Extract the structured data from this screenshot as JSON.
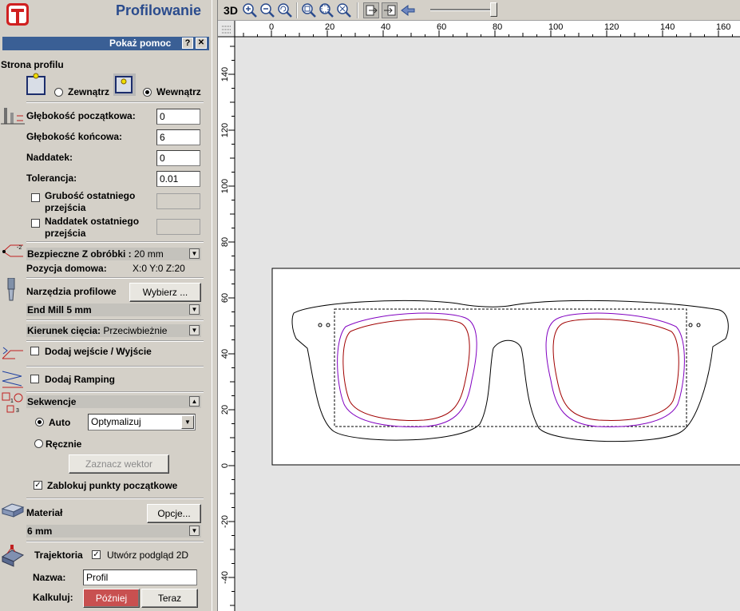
{
  "panel": {
    "title": "Profilowanie",
    "help_bar": "Pokaż pomoc",
    "help_q": "?",
    "help_close": "✕"
  },
  "profile_side": {
    "label": "Strona profilu",
    "outside": "Zewnątrz",
    "inside": "Wewnątrz",
    "selected": "inside"
  },
  "params": {
    "start_depth_label": "Głębokość początkowa:",
    "start_depth": "0",
    "end_depth_label": "Głębokość końcowa:",
    "end_depth": "6",
    "allowance_label": "Naddatek:",
    "allowance": "0",
    "tolerance_label": "Tolerancja:",
    "tolerance": "0.01",
    "last_pass_thickness_l1": "Grubość ostatniego",
    "last_pass_thickness_l2": "przejścia",
    "last_pass_allowance_l1": "Naddatek ostatniego",
    "last_pass_allowance_l2": "przejścia"
  },
  "safe_z": {
    "label": "Bezpieczne Z obróbki :",
    "value": "20 mm",
    "home_label": "Pozycja domowa:",
    "home_value": "X:0 Y:0 Z:20"
  },
  "tools": {
    "label": "Narzędzia profilowe",
    "select_button": "Wybierz ...",
    "tool_name": "End Mill 5 mm"
  },
  "direction": {
    "label": "Kierunek cięcia:",
    "value": "Przeciwbieżnie"
  },
  "leads": {
    "label": "Dodaj wejście / Wyjście"
  },
  "ramping": {
    "label": "Dodaj Ramping"
  },
  "sequence": {
    "label": "Sekwencje",
    "auto_label": "Auto",
    "auto_option": "Optymalizuj",
    "manual_label": "Ręcznie",
    "select_vector_button": "Zaznacz wektor",
    "lock_start_points": "Zablokuj punkty początkowe"
  },
  "material": {
    "label": "Materiał",
    "options_button": "Opcje...",
    "value": "6 mm"
  },
  "toolpath": {
    "label": "Trajektoria",
    "preview_2d": "Utwórz podgląd 2D",
    "name_label": "Nazwa:",
    "name_value": "Profil",
    "calc_label": "Kalkuluj:",
    "later_button": "Później",
    "now_button": "Teraz"
  },
  "toolbar": {
    "view3d": "3D"
  },
  "ruler": {
    "x_ticks": [
      "0",
      "20",
      "40",
      "60",
      "80",
      "100",
      "120",
      "140",
      "160"
    ],
    "y_ticks": [
      "140",
      "120",
      "100",
      "80",
      "60",
      "40",
      "20",
      "0",
      "-20",
      "-40"
    ]
  },
  "colors": {
    "header_blue": "#2a4b8d",
    "help_bar": "#3a5f95",
    "outline": "#000000",
    "inner_path": "#a00000",
    "outer_path": "#8000c0"
  }
}
